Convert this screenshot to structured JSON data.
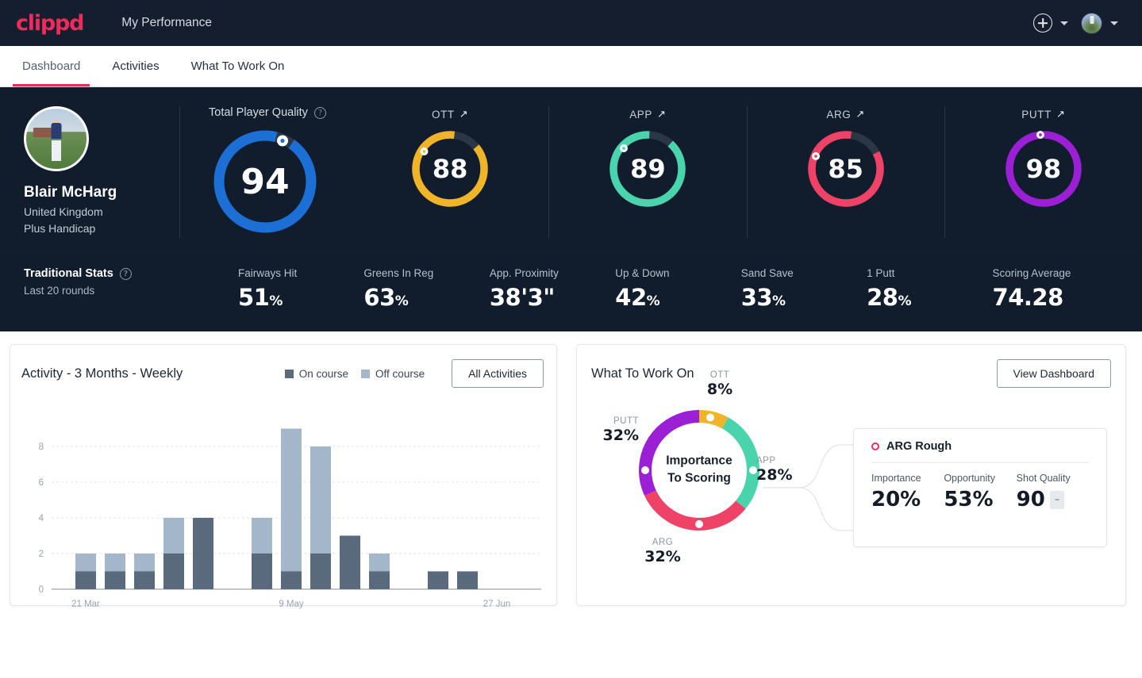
{
  "topbar": {
    "logo": "clippd",
    "title": "My Performance",
    "add_icon": "plus-circle-icon",
    "add_chevron": "chevron-down-icon",
    "avatar_chevron": "chevron-down-icon"
  },
  "tabs": [
    {
      "label": "Dashboard",
      "active": true
    },
    {
      "label": "Activities",
      "active": false
    },
    {
      "label": "What To Work On",
      "active": false
    }
  ],
  "player": {
    "name": "Blair McHarg",
    "country": "United Kingdom",
    "handicap": "Plus Handicap"
  },
  "tpq": {
    "label": "Total Player Quality",
    "help_icon": "question-mark-icon",
    "value": "94",
    "color": "#1c6fd4"
  },
  "sub_gauges": [
    {
      "label": "OTT",
      "trend_icon": "arrow-up-right-icon",
      "trend": "↗",
      "value": "88",
      "color": "#f0b429"
    },
    {
      "label": "APP",
      "trend_icon": "arrow-up-right-icon",
      "trend": "↗",
      "value": "89",
      "color": "#4ad4ad"
    },
    {
      "label": "ARG",
      "trend_icon": "arrow-up-right-icon",
      "trend": "↗",
      "value": "85",
      "color": "#ef4267"
    },
    {
      "label": "PUTT",
      "trend_icon": "arrow-up-right-icon",
      "trend": "↗",
      "value": "98",
      "color": "#9b1fd4"
    }
  ],
  "traditional": {
    "title": "Traditional Stats",
    "help_icon": "question-mark-icon",
    "subtitle": "Last 20 rounds",
    "stats": [
      {
        "label": "Fairways Hit",
        "value": "51",
        "unit": "%"
      },
      {
        "label": "Greens In Reg",
        "value": "63",
        "unit": "%"
      },
      {
        "label": "App. Proximity",
        "value": "38'3\"",
        "unit": ""
      },
      {
        "label": "Up & Down",
        "value": "42",
        "unit": "%"
      },
      {
        "label": "Sand Save",
        "value": "33",
        "unit": "%"
      },
      {
        "label": "1 Putt",
        "value": "28",
        "unit": "%"
      },
      {
        "label": "Scoring Average",
        "value": "74.28",
        "unit": ""
      }
    ]
  },
  "activity": {
    "title": "Activity - 3 Months - Weekly",
    "legend": [
      {
        "label": "On course",
        "color": "#586a7c"
      },
      {
        "label": "Off course",
        "color": "#a3b6ca"
      }
    ],
    "button": "All Activities"
  },
  "work": {
    "title": "What To Work On",
    "button": "View Dashboard",
    "center_line1": "Importance",
    "center_line2": "To Scoring",
    "detail": {
      "marker_icon": "circle-outline-icon",
      "title": "ARG Rough",
      "metrics": [
        {
          "label": "Importance",
          "value": "20%",
          "badge": ""
        },
        {
          "label": "Opportunity",
          "value": "53%",
          "badge": ""
        },
        {
          "label": "Shot Quality",
          "value": "90",
          "badge": "–"
        }
      ]
    }
  },
  "chart_data": [
    {
      "type": "bar",
      "title": "Activity - 3 Months - Weekly",
      "stacked": true,
      "xlabel": "",
      "ylabel": "",
      "ylim": [
        0,
        10
      ],
      "yticks": [
        0,
        2,
        4,
        6,
        8
      ],
      "grid": true,
      "legend_position": "top-right",
      "categories": [
        "",
        "21 Mar",
        "",
        "",
        "",
        "",
        "",
        "",
        "9 May",
        "",
        "",
        "",
        "",
        "",
        "",
        "27 Jun",
        ""
      ],
      "tick_labels": [
        {
          "index": 1,
          "label": "21 Mar"
        },
        {
          "index": 8,
          "label": "9 May"
        },
        {
          "index": 15,
          "label": "27 Jun"
        }
      ],
      "series": [
        {
          "name": "On course",
          "color": "#586a7c",
          "values": [
            0,
            1,
            1,
            1,
            2,
            4,
            0,
            2,
            1,
            2,
            3,
            1,
            0,
            1,
            1,
            0,
            0
          ]
        },
        {
          "name": "Off course",
          "color": "#a3b6ca",
          "values": [
            0,
            1,
            1,
            1,
            2,
            0,
            0,
            2,
            8,
            6,
            0,
            1,
            0,
            0,
            0,
            0,
            0
          ]
        }
      ]
    },
    {
      "type": "pie",
      "title": "Importance To Scoring",
      "donut": true,
      "labels": [
        "OTT",
        "APP",
        "ARG",
        "PUTT"
      ],
      "values": [
        8,
        28,
        32,
        32
      ],
      "value_labels": [
        "8%",
        "28%",
        "32%",
        "32%"
      ],
      "colors": [
        "#f0b429",
        "#4ad4ad",
        "#ef4267",
        "#9b1fd4"
      ]
    }
  ]
}
